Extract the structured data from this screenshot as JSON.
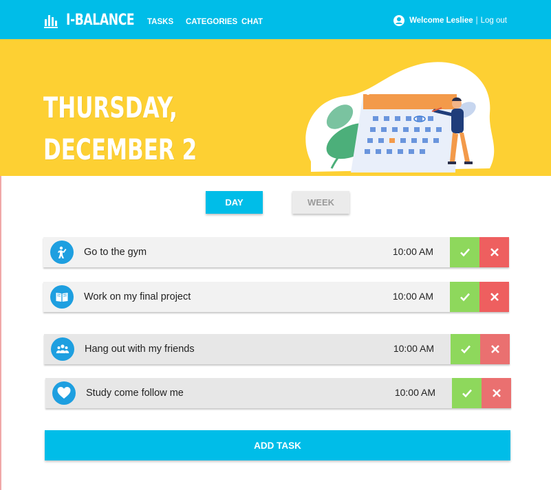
{
  "app": {
    "name": "I-BALANCE"
  },
  "nav": {
    "links": [
      "TASKS",
      "CATEGORIES",
      "CHAT"
    ],
    "welcome": "Welcome Lesliee",
    "separator": "|",
    "logout": "Log out"
  },
  "hero": {
    "line1": "THURSDAY,",
    "line2": "DECEMBER 2"
  },
  "view_toggle": {
    "day": "DAY",
    "week": "WEEK",
    "selected": "DAY"
  },
  "tasks": [
    {
      "label": "Go to the gym",
      "time": "10:00 AM",
      "icon": "exercise-icon"
    },
    {
      "label": "Work on my final project",
      "time": "10:00 AM",
      "icon": "book-icon"
    },
    {
      "label": "Hang out with my friends",
      "time": "10:00 AM",
      "icon": "group-icon"
    },
    {
      "label": "Study come follow me",
      "time": "10:00 AM",
      "icon": "heart-icon"
    }
  ],
  "add_task_label": "ADD TASK",
  "colors": {
    "primary": "#00bde8",
    "hero": "#fdd033",
    "done": "#8ed85c",
    "delete": "#ee5f5f",
    "task_icon": "#1e9fe0"
  }
}
